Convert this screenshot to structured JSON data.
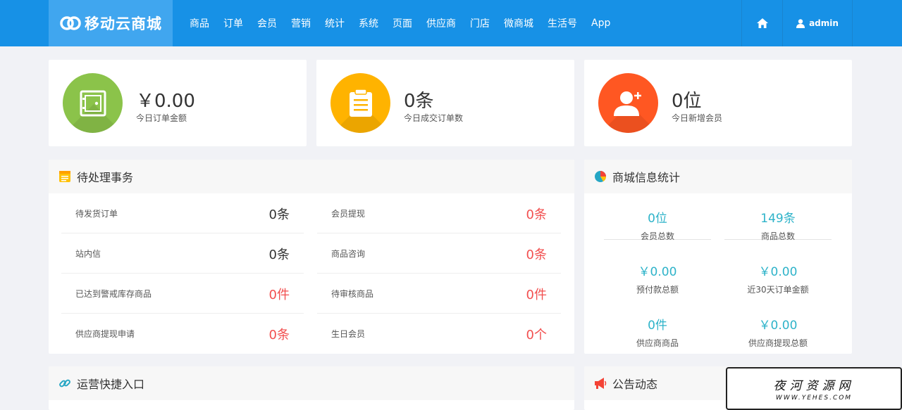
{
  "brand": {
    "name": "移动云商城"
  },
  "nav": {
    "items": [
      "商品",
      "订单",
      "会员",
      "营销",
      "统计",
      "系统",
      "页面",
      "供应商",
      "门店",
      "微商城",
      "生活号",
      "App"
    ],
    "user": "admin"
  },
  "stats": [
    {
      "value": "￥0.00",
      "label": "今日订单金额",
      "color": "#8bc34a",
      "icon": "safe-box-icon"
    },
    {
      "value": "0条",
      "label": "今日成交订单数",
      "color": "#ffb300",
      "icon": "clipboard-icon"
    },
    {
      "value": "0位",
      "label": "今日新增会员",
      "color": "#ff5722",
      "icon": "add-user-icon"
    }
  ],
  "todo": {
    "title": "待处理事务",
    "items": [
      {
        "label": "待发货订单",
        "value": "0条"
      },
      {
        "label": "会员提现",
        "value": "0条"
      },
      {
        "label": "站内信",
        "value": "0条"
      },
      {
        "label": "商品咨询",
        "value": "0条"
      },
      {
        "label": "已达到警戒库存商品",
        "value": "0件"
      },
      {
        "label": "待审核商品",
        "value": "0件"
      },
      {
        "label": "供应商提现申请",
        "value": "0条"
      },
      {
        "label": "生日会员",
        "value": "0个"
      }
    ]
  },
  "shop_stats": {
    "title": "商城信息统计",
    "items": [
      {
        "value": "0位",
        "label": "会员总数"
      },
      {
        "value": "149条",
        "label": "商品总数"
      },
      {
        "value": "￥0.00",
        "label": "预付款总额"
      },
      {
        "value": "￥0.00",
        "label": "近30天订单金额"
      },
      {
        "value": "0件",
        "label": "供应商商品"
      },
      {
        "value": "￥0.00",
        "label": "供应商提现总额"
      }
    ]
  },
  "shortcuts": {
    "title": "运营快捷入口"
  },
  "notices": {
    "title": "公告动态"
  },
  "watermark": {
    "title": "夜河资源网",
    "url": "WWW.YEHES.COM"
  }
}
